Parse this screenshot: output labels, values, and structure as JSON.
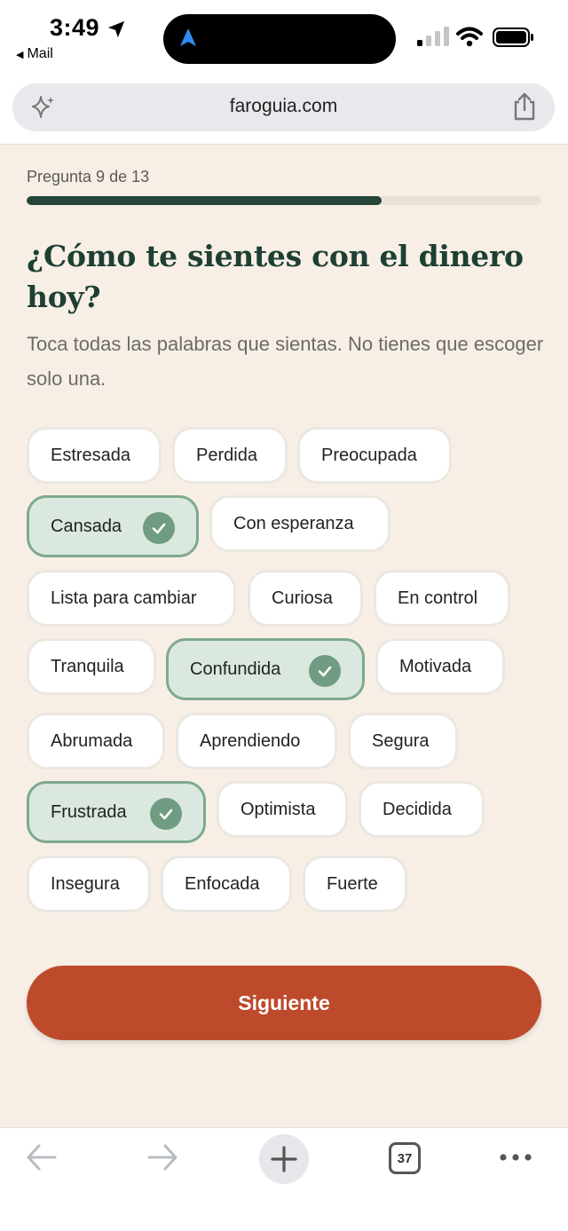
{
  "status_bar": {
    "time": "3:49",
    "back_app": "Mail"
  },
  "browser": {
    "url": "faroguia.com",
    "tab_count": "37"
  },
  "progress": {
    "label": "Pregunta 9 de 13",
    "fraction": 0.69
  },
  "question": {
    "title": "¿Cómo te sientes con el dinero hoy?",
    "subtitle": "Toca todas las palabras que sientas. No tienes que escoger solo una."
  },
  "options": [
    {
      "label": "Estresada",
      "selected": false
    },
    {
      "label": "Perdida",
      "selected": false
    },
    {
      "label": "Preocupada",
      "selected": false
    },
    {
      "label": "Cansada",
      "selected": true
    },
    {
      "label": "Con esperanza",
      "selected": false
    },
    {
      "label": "Lista para cambiar",
      "selected": false
    },
    {
      "label": "Curiosa",
      "selected": false
    },
    {
      "label": "En control",
      "selected": false
    },
    {
      "label": "Tranquila",
      "selected": false
    },
    {
      "label": "Confundida",
      "selected": true
    },
    {
      "label": "Motivada",
      "selected": false
    },
    {
      "label": "Abrumada",
      "selected": false
    },
    {
      "label": "Aprendiendo",
      "selected": false
    },
    {
      "label": "Segura",
      "selected": false
    },
    {
      "label": "Frustrada",
      "selected": true
    },
    {
      "label": "Optimista",
      "selected": false
    },
    {
      "label": "Decidida",
      "selected": false
    },
    {
      "label": "Insegura",
      "selected": false
    },
    {
      "label": "Enfocada",
      "selected": false
    },
    {
      "label": "Fuerte",
      "selected": false
    }
  ],
  "next_button": {
    "label": "Siguiente"
  },
  "colors": {
    "accent": "#bd4a2b",
    "heading": "#1e3f33",
    "progress_fill": "#234639",
    "selected_chip": "#dbe8df",
    "check": "#6f9c82",
    "background": "#f7efe6"
  }
}
